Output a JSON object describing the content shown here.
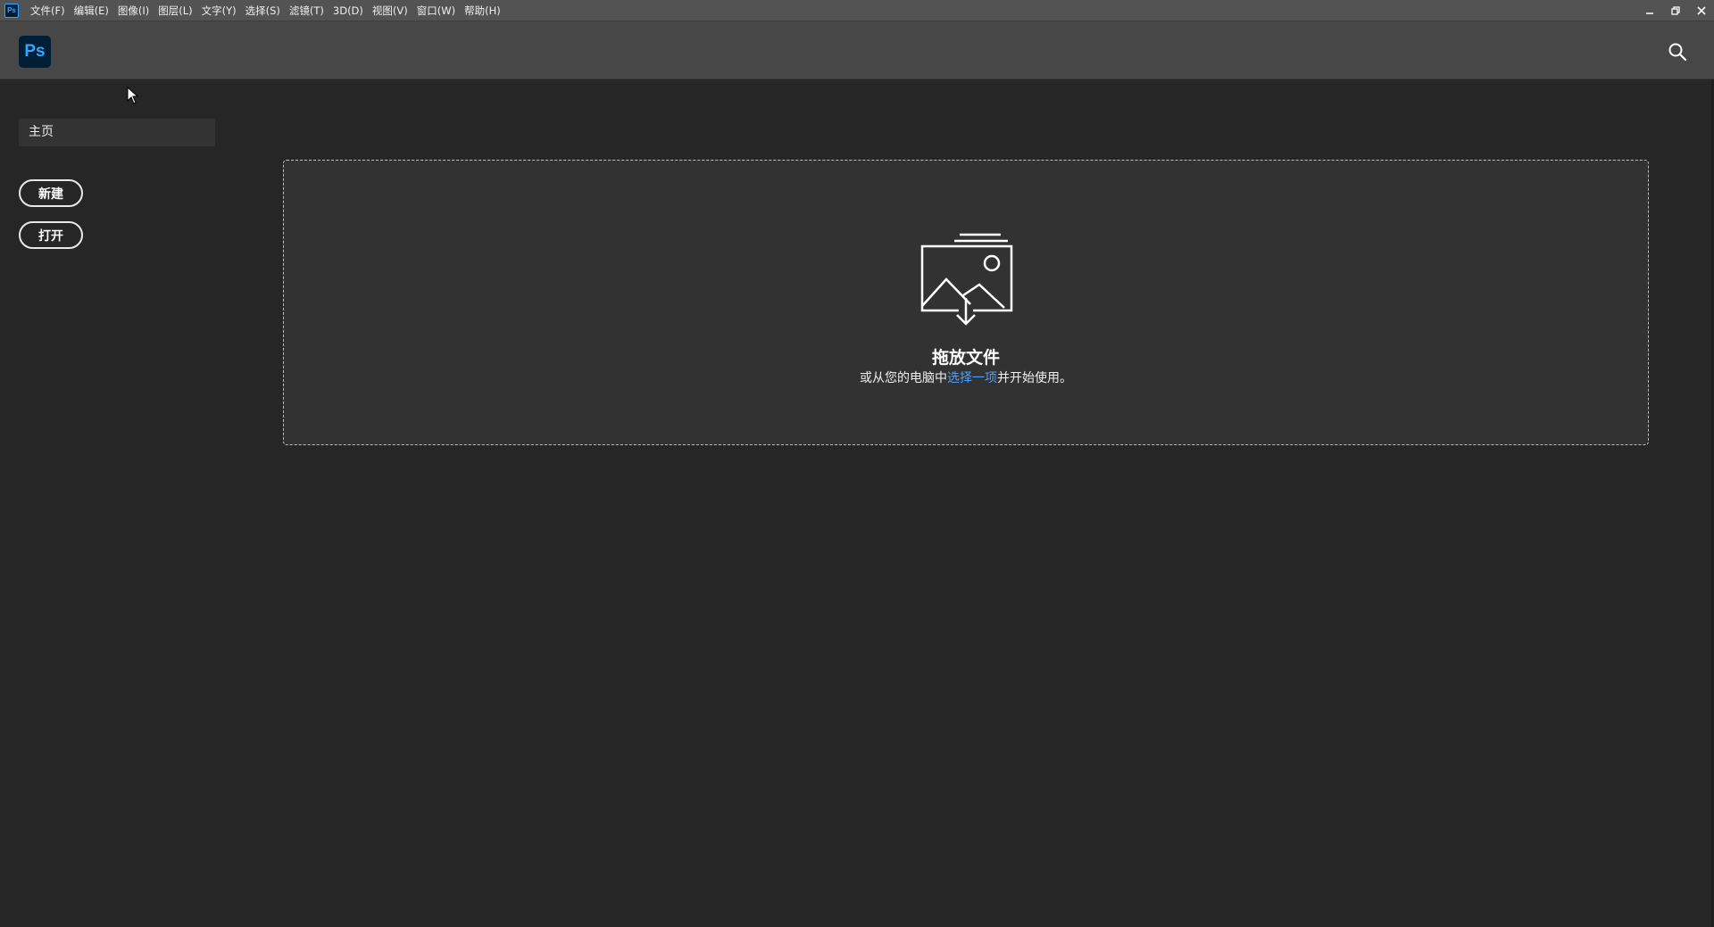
{
  "titlebar": {
    "app_icon_text": "Ps",
    "menu": [
      "文件(F)",
      "编辑(E)",
      "图像(I)",
      "图层(L)",
      "文字(Y)",
      "选择(S)",
      "滤镜(T)",
      "3D(D)",
      "视图(V)",
      "窗口(W)",
      "帮助(H)"
    ]
  },
  "header": {
    "logo_text": "Ps"
  },
  "sidebar": {
    "home_label": "主页",
    "new_label": "新建",
    "open_label": "打开"
  },
  "dropzone": {
    "title": "拖放文件",
    "subtitle_prefix": "或从您的电脑中",
    "subtitle_link": "选择一项",
    "subtitle_suffix": "并开始使用。"
  },
  "colors": {
    "background": "#262626",
    "header": "#474747",
    "titlebar": "#535353",
    "brand_dark": "#001e36",
    "brand_blue": "#31a8ff",
    "link": "#4ba0ff"
  }
}
